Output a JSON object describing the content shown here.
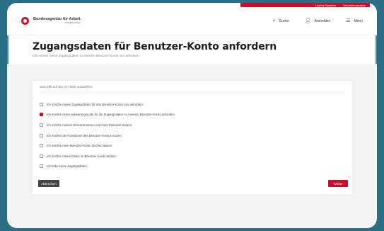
{
  "topbar": {
    "links": [
      "Leichte Sprache",
      "Gebärdensprache"
    ]
  },
  "header": {
    "logo_line1": "Bundesagentur für Arbeit",
    "logo_line2": "Bürgerportal",
    "nav": [
      {
        "label": "Suche",
        "icon": "search-icon"
      },
      {
        "label": "Anmelden",
        "icon": "user-icon"
      },
      {
        "label": "Menü",
        "icon": "menu-icon"
      }
    ]
  },
  "page": {
    "title": "Zugangsdaten für Benutzer-Konto anfordern",
    "subtitle": "Ich möchte meine Zugangsdaten zu meinem Benutzer-Konto neu anfordern."
  },
  "card": {
    "header": "Was trifft auf Sie zu? Bitte auswählen:",
    "options": [
      {
        "label": "Ich möchte meine Zugangsdaten für das Benutzer-Konto neu anfordern.",
        "checked": false
      },
      {
        "label": "Ich möchte einen Aktivierungscode für die Zugangsdaten zu meinem Benutzer-Konto anfordern.",
        "checked": true
      },
      {
        "label": "Ich möchte meinen Benutzernamen und mein Passwort ändern.",
        "checked": false
      },
      {
        "label": "Ich möchte die Funktionen des Benutzer-Kontos nutzen.",
        "checked": false
      },
      {
        "label": "Ich möchte mein Benutzer-Konto löschen lassen.",
        "checked": false
      },
      {
        "label": "Ich möchte meine Daten im Benutzer-Konto ändern.",
        "checked": false
      },
      {
        "label": "Ich habe keine Zugangsdaten.",
        "checked": false
      }
    ],
    "cancel_label": "Abbrechen",
    "next_label": "Weiter"
  },
  "colors": {
    "brand": "#c8102e",
    "frame": "#2b6f86"
  }
}
